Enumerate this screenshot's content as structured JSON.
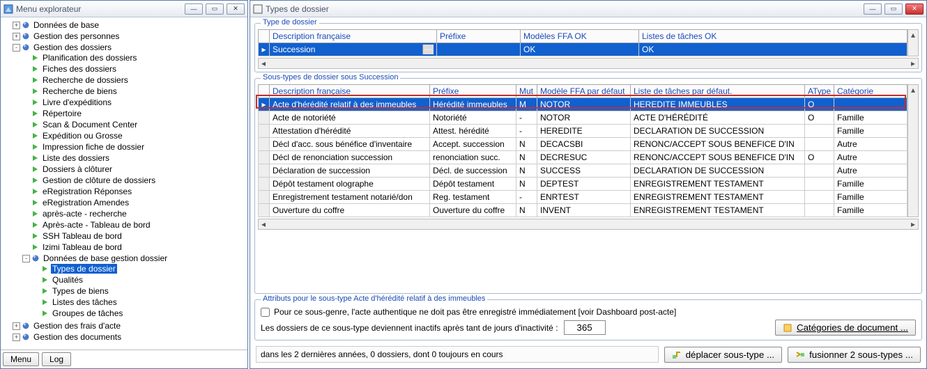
{
  "left_window": {
    "title": "Menu explorateur",
    "bottom_buttons": {
      "menu": "Menu",
      "log": "Log"
    }
  },
  "tree": {
    "top": [
      {
        "label": "Données de base"
      },
      {
        "label": "Gestion des personnes"
      }
    ],
    "gestion_label": "Gestion des dossiers",
    "gestion_children": [
      "Planification des dossiers",
      "Fiches des dossiers",
      "Recherche de dossiers",
      "Recherche de biens",
      "Livre d'expéditions",
      "Répertoire",
      "Scan & Document Center",
      "Expédition ou Grosse",
      "Impression fiche de dossier",
      "Liste des dossiers",
      "Dossiers à clôturer",
      "Gestion de clôture de dossiers",
      "eRegistration Réponses",
      "eRegistration Amendes",
      "après-acte - recherche",
      "Après-acte - Tableau de bord",
      "SSH Tableau de bord",
      "Izimi Tableau de bord"
    ],
    "donnees_base_label": "Données de base gestion dossier",
    "donnees_base_children": [
      {
        "label": "Types de dossier",
        "selected": true
      },
      {
        "label": "Qualités"
      },
      {
        "label": "Types de biens"
      },
      {
        "label": "Listes des tâches"
      },
      {
        "label": "Groupes de tâches"
      }
    ],
    "bottom": [
      "Gestion des frais d'acte",
      "Gestion des documents"
    ]
  },
  "right_window": {
    "title": "Types de dossier"
  },
  "type_dossier": {
    "legend": "Type de dossier",
    "cols": [
      "Description française",
      "Préfixe",
      "Modèles FFA OK",
      "Listes de tâches OK"
    ],
    "row": {
      "desc": "Succession",
      "prefixe": "",
      "ffa": "OK",
      "listes": "OK"
    }
  },
  "sous_types": {
    "legend": "Sous-types de dossier sous Succession",
    "cols": [
      "Description française",
      "Préfixe",
      "Mut",
      "Modèle FFA par défaut",
      "Liste de tâches par défaut.",
      "AType",
      "Catégorie"
    ],
    "rows": [
      {
        "sel": true,
        "c": [
          "Acte d'hérédité relatif à des immeubles",
          "Hérédité immeubles",
          "M",
          "NOTOR",
          "HEREDITE IMMEUBLES",
          "O",
          ""
        ]
      },
      {
        "c": [
          "Acte de notoriété",
          "Notoriété",
          "-",
          "NOTOR",
          "ACTE D'HÉRÉDITÉ",
          "O",
          "Famille"
        ]
      },
      {
        "c": [
          "Attestation d'hérédité",
          "Attest. hérédité",
          "-",
          "HEREDITE",
          "DECLARATION DE SUCCESSION",
          "",
          "Famille"
        ]
      },
      {
        "c": [
          "Décl d'acc. sous bénéfice d'inventaire",
          "Accept. succession",
          "N",
          "DECACSBI",
          "RENONC/ACCEPT SOUS BENEFICE D'IN",
          "",
          "Autre"
        ]
      },
      {
        "c": [
          "Décl de renonciation succession",
          "renonciation succ.",
          "N",
          "DECRESUC",
          "RENONC/ACCEPT SOUS BENEFICE D'IN",
          "O",
          "Autre"
        ]
      },
      {
        "c": [
          "Déclaration de succession",
          "Décl. de succession",
          "N",
          "SUCCESS",
          "DECLARATION DE SUCCESSION",
          "",
          "Autre"
        ]
      },
      {
        "c": [
          "Dépôt testament olographe",
          "Dépôt testament",
          "N",
          "DEPTEST",
          "ENREGISTREMENT TESTAMENT",
          "",
          "Famille"
        ]
      },
      {
        "c": [
          "Enregistrement testament notarié/don",
          "Reg. testament",
          "-",
          "ENRTEST",
          "ENREGISTREMENT TESTAMENT",
          "",
          "Famille"
        ]
      },
      {
        "c": [
          "Ouverture du coffre",
          "Ouverture du coffre",
          "N",
          "INVENT",
          "ENREGISTREMENT TESTAMENT",
          "",
          "Famille"
        ]
      }
    ]
  },
  "attrs": {
    "legend": "Attributs pour le sous-type Acte d'hérédité relatif à des immeubles",
    "chk_label": "Pour ce sous-genre, l'acte authentique ne doit pas être enregistré immédiatement [voir Dashboard post-acte]",
    "inactive_label": "Les dossiers de ce sous-type deviennent inactifs après tant de jours d'inactivité :",
    "inactive_days": "365",
    "cat_btn": "Catégories de document ..."
  },
  "footer": {
    "status": "dans les 2 dernières années, 0 dossiers, dont 0 toujours en cours",
    "move_btn": "déplacer sous-type ...",
    "merge_btn": "fusionner 2 sous-types ..."
  }
}
